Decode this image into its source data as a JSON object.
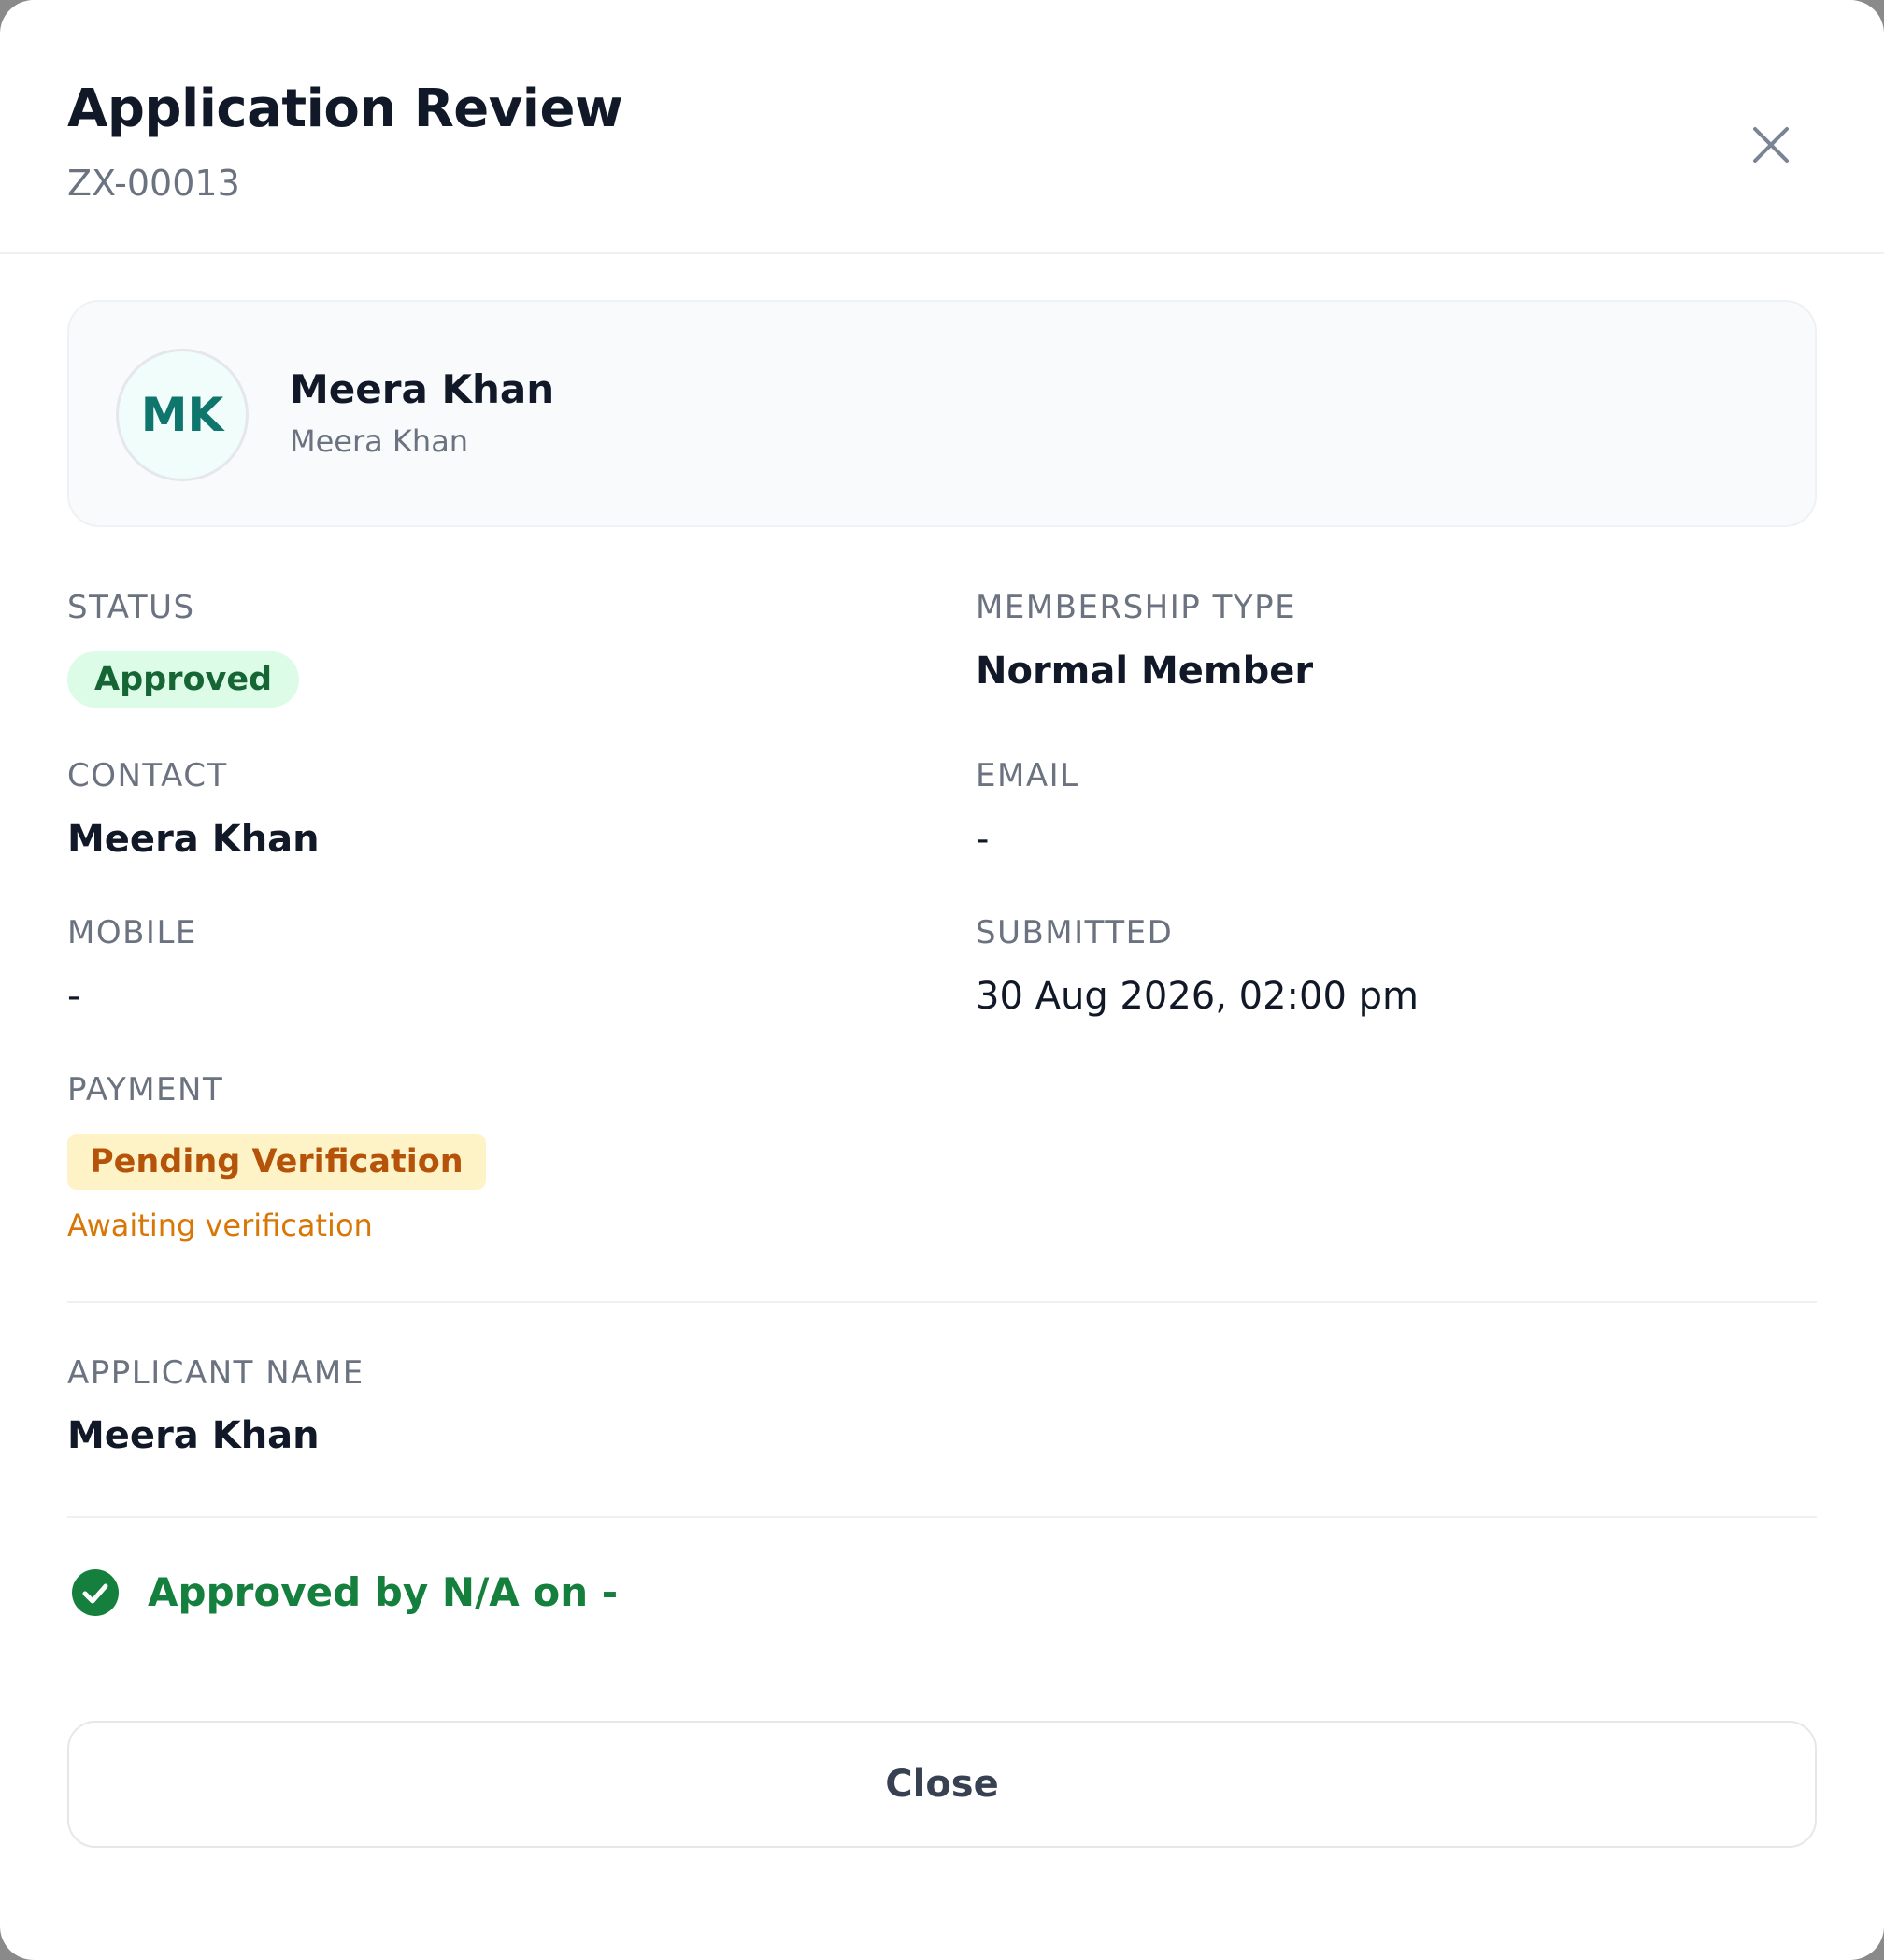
{
  "header": {
    "title": "Application Review",
    "application_id": "ZX-00013",
    "close_icon": "close-icon"
  },
  "profile": {
    "initials": "MK",
    "name": "Meera Khan",
    "secondary_name": "Meera Khan"
  },
  "fields": {
    "status": {
      "label": "STATUS",
      "value": "Approved"
    },
    "membership_type": {
      "label": "MEMBERSHIP TYPE",
      "value": "Normal Member"
    },
    "contact": {
      "label": "CONTACT",
      "value": "Meera Khan"
    },
    "email": {
      "label": "EMAIL",
      "value": "-"
    },
    "mobile": {
      "label": "MOBILE",
      "value": "-"
    },
    "submitted": {
      "label": "SUBMITTED",
      "value": "30 Aug 2026, 02:00 pm"
    },
    "payment": {
      "label": "PAYMENT",
      "value": "Pending Verification",
      "note": "Awaiting verification"
    }
  },
  "applicant": {
    "label": "APPLICANT NAME",
    "value": "Meera Khan"
  },
  "approval": {
    "icon": "check-circle-icon",
    "text": "Approved by N/A on -"
  },
  "footer": {
    "close_label": "Close"
  },
  "colors": {
    "title": "#111827",
    "muted": "#6b7280",
    "approved_bg": "#dcfce7",
    "approved_text": "#166534",
    "pending_bg": "#fef3c7",
    "pending_text": "#b45309",
    "pending_note": "#d97706",
    "success": "#15803d",
    "avatar_text": "#0f766e"
  }
}
